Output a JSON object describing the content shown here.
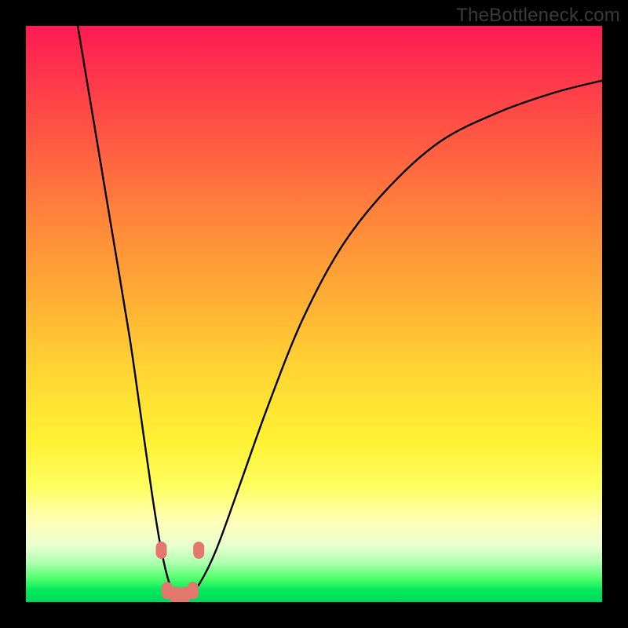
{
  "watermark": "TheBottleneck.com",
  "chart_data": {
    "type": "line",
    "title": "",
    "xlabel": "",
    "ylabel": "",
    "xlim": [
      0,
      100
    ],
    "ylim": [
      0,
      100
    ],
    "series": [
      {
        "name": "bottleneck-curve",
        "x": [
          9,
          12,
          15,
          18,
          20,
          22,
          23.5,
          25,
          26.5,
          28,
          30,
          33,
          37,
          42,
          48,
          55,
          63,
          72,
          82,
          92,
          100
        ],
        "values": [
          100,
          82,
          64,
          46,
          32,
          18,
          9,
          3,
          1,
          1,
          3,
          9,
          20,
          34,
          49,
          62,
          72,
          80,
          85,
          88.5,
          90.5
        ]
      }
    ],
    "markers": [
      {
        "x": 23.5,
        "y": 9
      },
      {
        "x": 30,
        "y": 9
      },
      {
        "x": 24.5,
        "y": 2
      },
      {
        "x": 26,
        "y": 1.2
      },
      {
        "x": 27.5,
        "y": 1.2
      },
      {
        "x": 29,
        "y": 2
      }
    ],
    "background_gradient": [
      "#ff1a53",
      "#ff6a3f",
      "#ffb034",
      "#fff133",
      "#ffffb8",
      "#00d85a"
    ]
  }
}
